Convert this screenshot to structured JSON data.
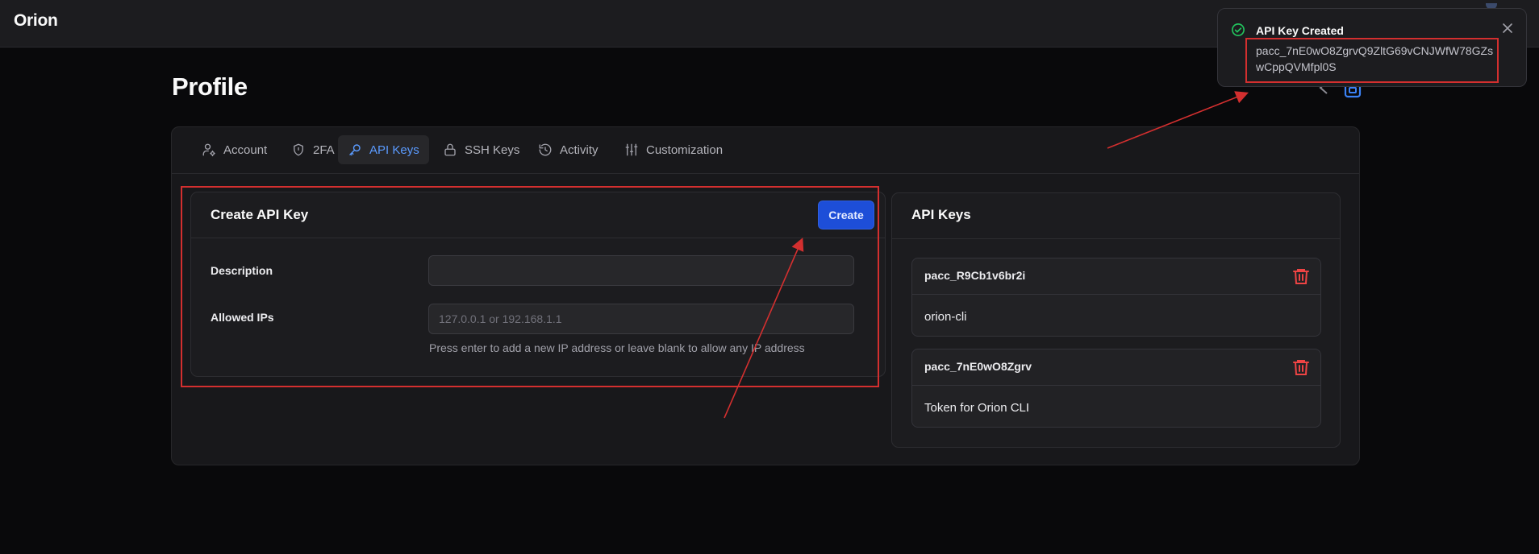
{
  "app": {
    "brand": "Orion"
  },
  "page": {
    "title": "Profile"
  },
  "tabs": [
    {
      "label": "Account",
      "icon": "user-cog-icon",
      "active": false
    },
    {
      "label": "2FA",
      "icon": "shield-icon",
      "active": false
    },
    {
      "label": "API Keys",
      "icon": "key-icon",
      "active": true
    },
    {
      "label": "SSH Keys",
      "icon": "lock-icon",
      "active": false
    },
    {
      "label": "Activity",
      "icon": "history-icon",
      "active": false
    },
    {
      "label": "Customization",
      "icon": "sliders-icon",
      "active": false
    }
  ],
  "create_panel": {
    "title": "Create API Key",
    "create_label": "Create",
    "description_label": "Description",
    "description_value": "",
    "allowed_ips_label": "Allowed IPs",
    "allowed_ips_placeholder": "127.0.0.1 or 192.168.1.1",
    "allowed_ips_hint": "Press enter to add a new IP address or leave blank to allow any IP address"
  },
  "keys_panel": {
    "title": "API Keys",
    "keys": [
      {
        "id": "pacc_R9Cb1v6br2i",
        "description": "orion-cli"
      },
      {
        "id": "pacc_7nE0wO8Zgrv",
        "description": "Token for Orion CLI"
      }
    ]
  },
  "toast": {
    "title": "API Key Created",
    "message": "pacc_7nE0wO8ZgrvQ9ZltG69vCNJWfW78GZswCppQVMfpl0S",
    "status": "success"
  },
  "colors": {
    "accent": "#1d4ed8",
    "active_tab": "#5b9bff",
    "danger": "#ef4444",
    "success": "#22c55e",
    "annotation": "#d32f2f"
  }
}
